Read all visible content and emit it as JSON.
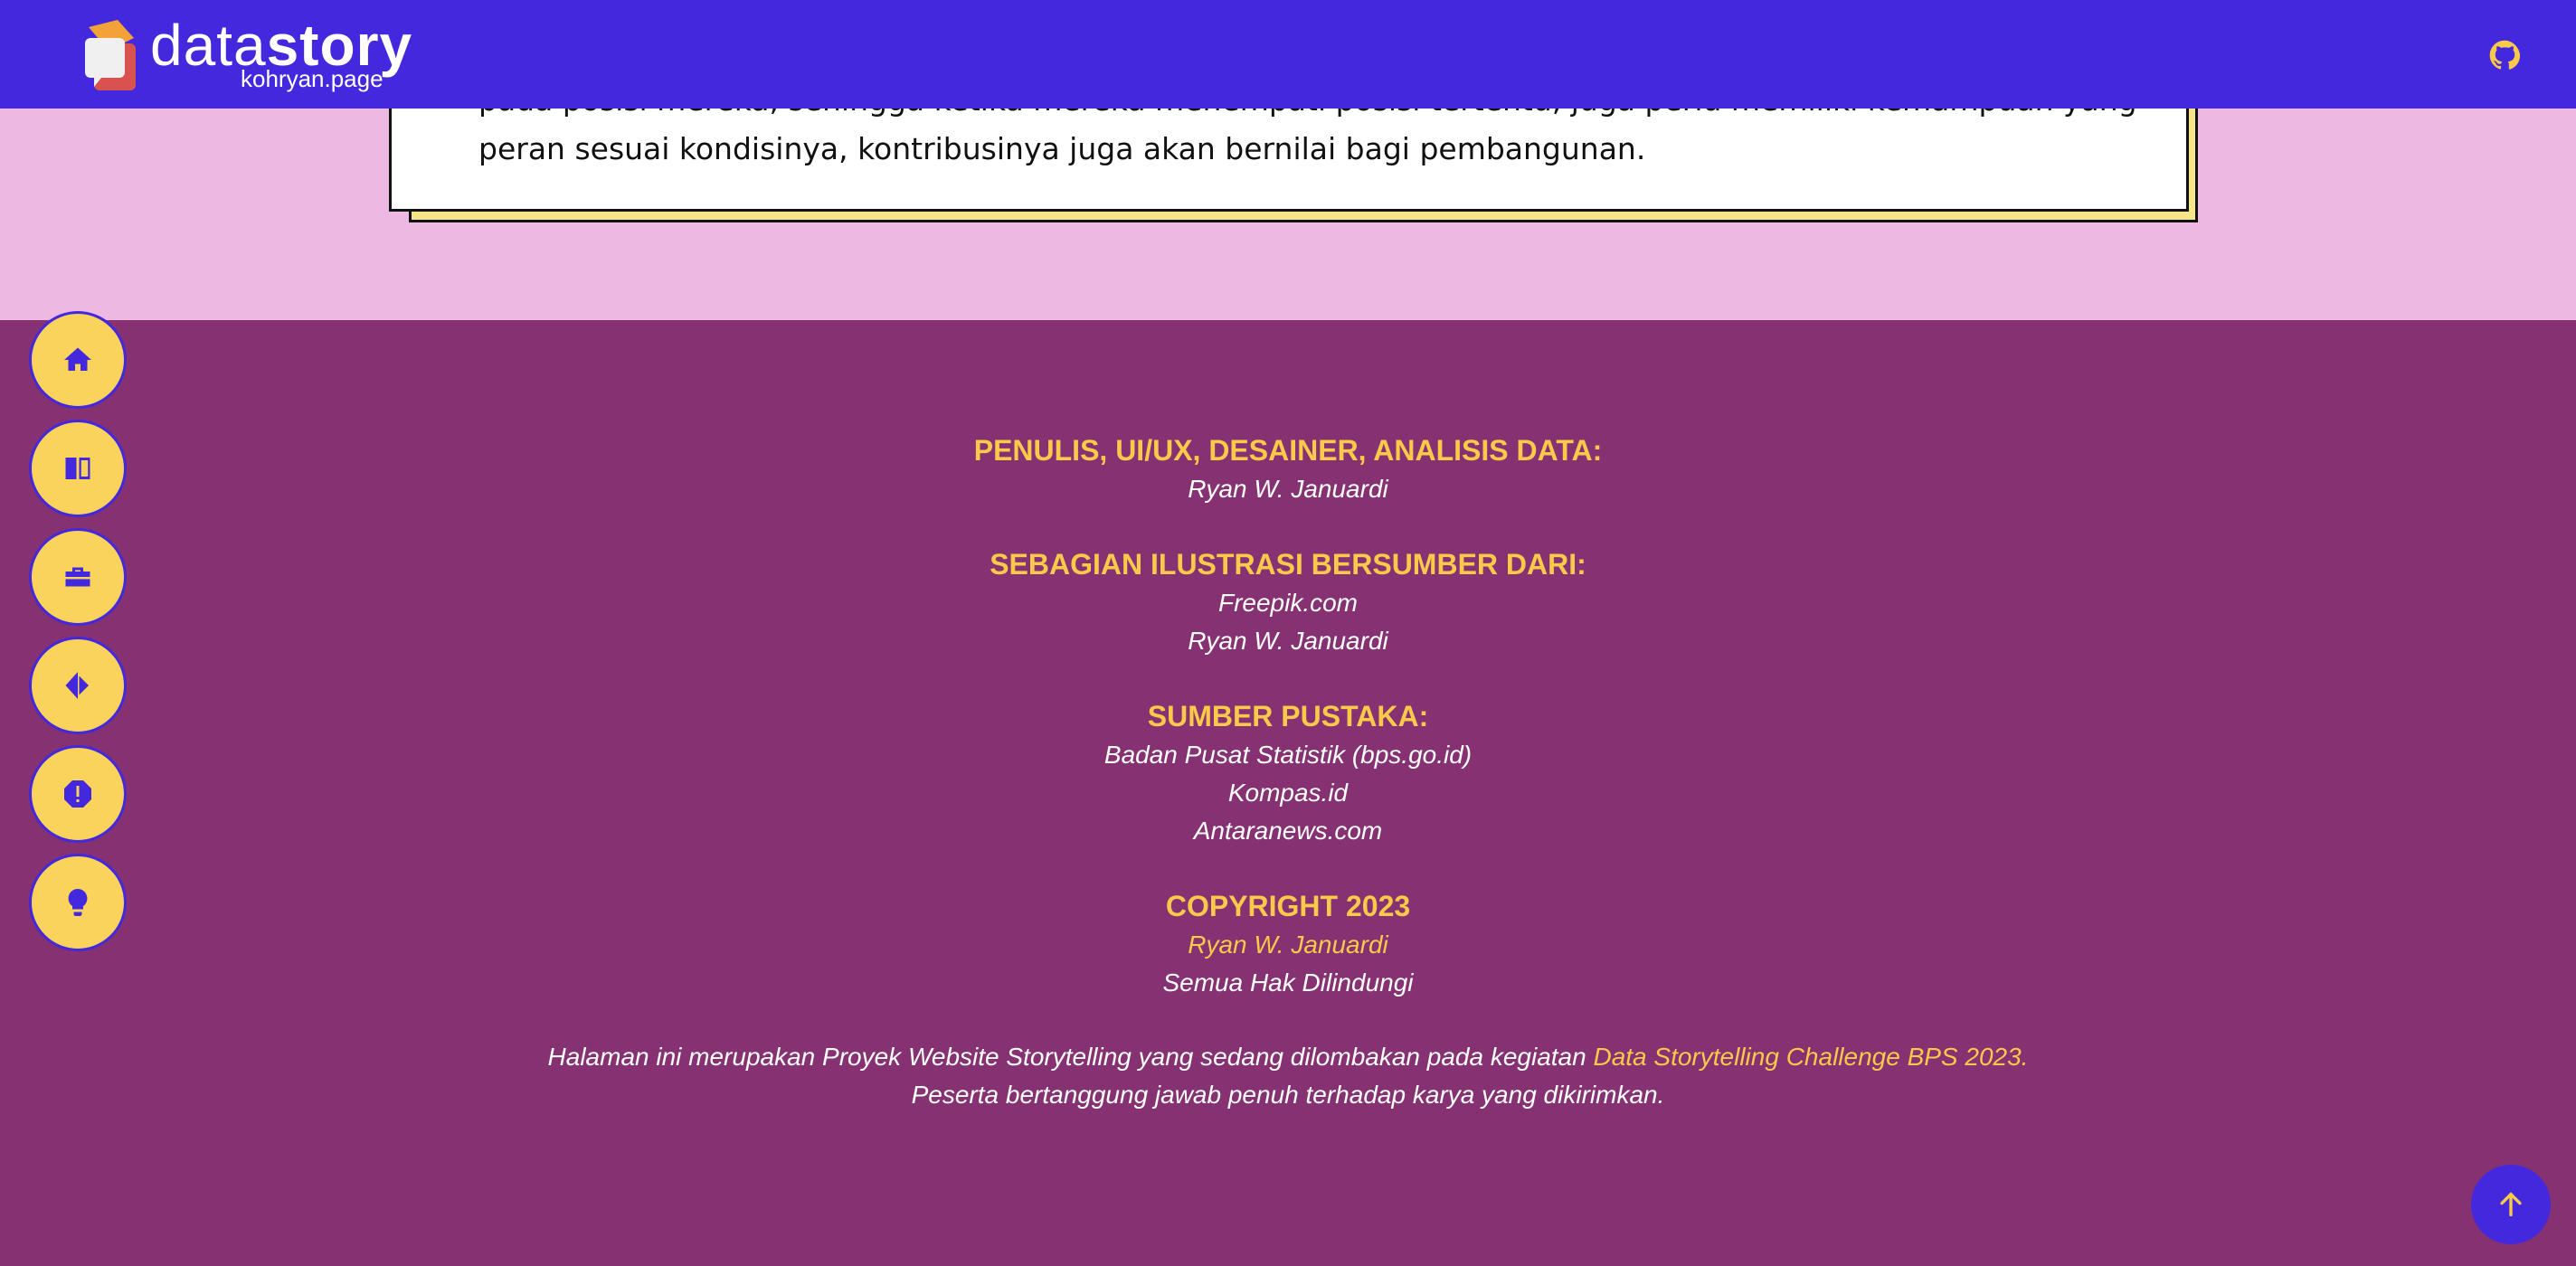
{
  "header": {
    "logo_light": "data",
    "logo_bold": "story",
    "logo_sub": "kohryan.page",
    "github_icon": "github-icon"
  },
  "article": {
    "line_partial": "pada posisi mereka, sehingga ketika mereka menempati posisi tertentu, juga perlu memiliki kemampuan yang",
    "line_last": "peran sesuai kondisinya, kontribusinya juga akan bernilai bagi pembangunan."
  },
  "sidenav": {
    "items": [
      {
        "icon": "home-icon"
      },
      {
        "icon": "book-icon"
      },
      {
        "icon": "toolbox-icon"
      },
      {
        "icon": "compass-icon"
      },
      {
        "icon": "alert-icon"
      },
      {
        "icon": "lightbulb-icon"
      }
    ]
  },
  "footer": {
    "credits_heading": "PENULIS, UI/UX, DESAINER, ANALISIS DATA:",
    "credits_name": "Ryan W. Januardi",
    "illustration_heading": "SEBAGIAN ILUSTRASI BERSUMBER DARI:",
    "illustration_sources": [
      "Freepik.com",
      "Ryan W. Januardi"
    ],
    "references_heading": "SUMBER PUSTAKA:",
    "references": [
      "Badan Pusat Statistik (bps.go.id)",
      "Kompas.id",
      "Antaranews.com"
    ],
    "copyright_heading": "COPYRIGHT 2023",
    "copyright_name": "Ryan W. Januardi",
    "copyright_rights": "Semua Hak Dilindungi",
    "note_prefix": "Halaman ini merupakan Proyek Website Storytelling yang sedang dilombakan pada kegiatan ",
    "note_link": "Data Storytelling Challenge BPS 2023.",
    "note_line2": "Peserta bertanggung jawab penuh terhadap karya yang dikirimkan."
  },
  "to_top": {
    "icon": "arrow-up-icon"
  },
  "colors": {
    "header": "#4428dd",
    "page_bg": "#edb9e3",
    "footer_bg": "#853172",
    "accent": "#f9c94a",
    "nav_button": "#f9d35b"
  }
}
